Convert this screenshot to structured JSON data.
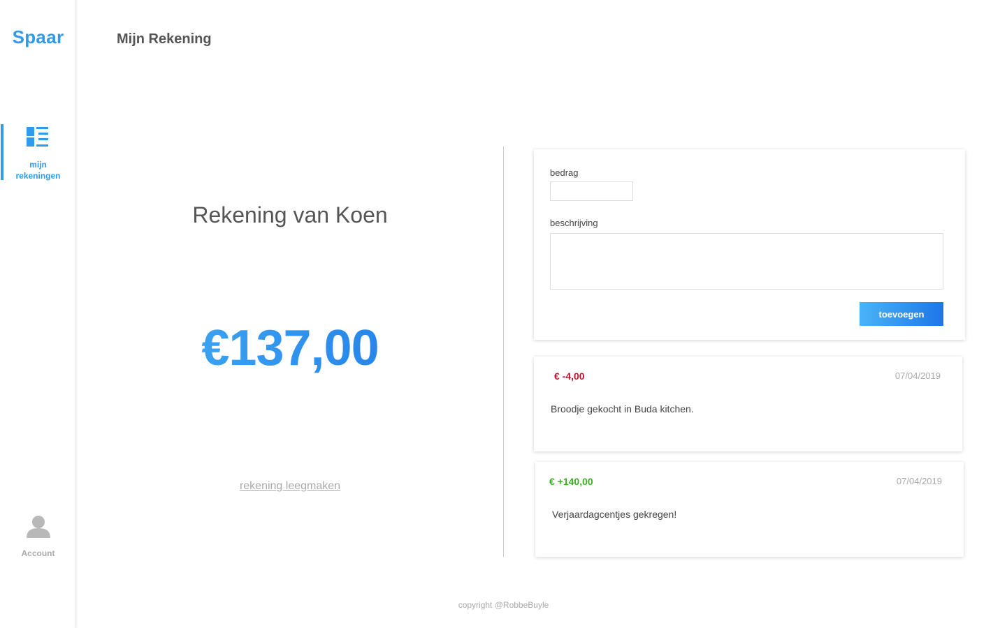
{
  "sidebar": {
    "logo": "Spaar",
    "nav": [
      {
        "label_line1": "mijn",
        "label_line2": "rekeningen",
        "icon": "list-layout-icon",
        "active": true
      }
    ],
    "account_label": "Account",
    "account_icon": "user-icon"
  },
  "header": {
    "title": "Mijn Rekening"
  },
  "account": {
    "name": "Rekening van Koen",
    "balance": "€137,00",
    "clear_link": "rekening leegmaken"
  },
  "form": {
    "amount_label": "bedrag",
    "amount_value": "",
    "description_label": "beschrijving",
    "description_value": "",
    "submit_label": "toevoegen"
  },
  "transactions": [
    {
      "amount": "€ -4,00",
      "date": "07/04/2019",
      "description": "Broodje gekocht in Buda kitchen.",
      "type": "negative"
    },
    {
      "amount": "€ +140,00",
      "date": "07/04/2019",
      "description": "Verjaardagcentjes gekregen!",
      "type": "positive"
    }
  ],
  "footer": {
    "copyright": "copyright @RobbeBuyle"
  },
  "colors": {
    "accent": "#2f9bea",
    "negative": "#c8102e",
    "positive": "#35b21b",
    "muted": "#aaaaaa"
  }
}
